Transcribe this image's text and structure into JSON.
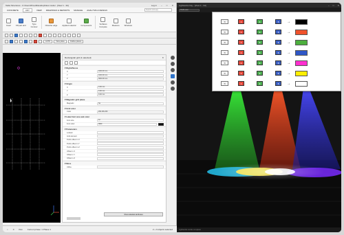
{
  "left_window": {
    "title": "Tekla Structures - C:\\Users\\Proud\\Desktop\\New model - [View 1 - 3d]",
    "user": "Log in",
    "menu_tabs": [
      "CONCRETE",
      "ANY",
      "VIEW",
      "DRAWINGS & REPORTS",
      "MANAGE",
      "ANALYSIS & DESIGN"
    ],
    "active_tab": "ANY",
    "search_placeholder": "Search (Ctrl+Q)",
    "ribbon": [
      {
        "label": "Insert",
        "icon": "insert-icon",
        "color": "plain"
      },
      {
        "label": "Fill part and",
        "icon": "fill-part-icon",
        "color": "blue"
      },
      {
        "label": "Type\nContour",
        "icon": "contour-icon",
        "color": "plain"
      },
      {
        "label": "Chamfer edge",
        "icon": "chamfer-icon",
        "color": "orange"
      },
      {
        "label": "Applied material",
        "icon": "material-icon",
        "color": "plain"
      },
      {
        "label": "Components",
        "icon": "components-icon",
        "color": "green"
      },
      {
        "label": "Surfaces\nCompare",
        "icon": "surface-icon",
        "color": "plain"
      },
      {
        "label": "Measure",
        "icon": "measure-icon",
        "color": "plain"
      },
      {
        "label": "Windows",
        "icon": "window-icon",
        "color": "plain"
      }
    ],
    "toolbar_dropdowns": [
      "AUTO",
      "View plane",
      "Outline planes"
    ],
    "viewport_title": "View 1 - 3d",
    "properties": {
      "title": "Rectangular grid (1 selected)",
      "sections": [
        {
          "name": "Right/Above",
          "rows": [
            {
              "k": "X",
              "v": "1000.00 mm"
            },
            {
              "k": "Y",
              "v": "1000.00 mm"
            },
            {
              "k": "Z",
              "v": "3000.00 mm"
            }
          ]
        },
        {
          "name": "Origin",
          "rows": [
            {
              "k": "X",
              "v": "0.00 mm"
            },
            {
              "k": "Y",
              "v": "0.00 mm"
            },
            {
              "k": "Z",
              "v": "0.00 mm"
            }
          ]
        },
        {
          "name": "Magnetic grid plane",
          "rows": [
            {
              "k": "Magnetic",
              "v": "No"
            }
          ]
        },
        {
          "name": "Grid color",
          "rows": [
            {
              "k": "Color",
              "v": "255 255 255"
            }
          ]
        },
        {
          "name": "Label font size and color",
          "rows": [
            {
              "k": "Font size",
              "v": "12"
            },
            {
              "k": "Font color",
              "v": "0000"
            }
          ]
        },
        {
          "name": "Parameters",
          "rows": [
            {
              "k": "Locked",
              "v": ""
            },
            {
              "k": "Grid element",
              "v": ""
            },
            {
              "k": "Prefix offset in X",
              "v": ""
            },
            {
              "k": "Prefix offset in Y",
              "v": ""
            },
            {
              "k": "Prefix offset in Z",
              "v": ""
            },
            {
              "k": "Offset in X",
              "v": ""
            },
            {
              "k": "Offset in Y",
              "v": ""
            },
            {
              "k": "Offset in Z",
              "v": ""
            }
          ]
        },
        {
          "name": "More",
          "rows": [
            {
              "k": "UDAs",
              "v": ""
            }
          ]
        }
      ],
      "button": "Show labelled attributes"
    },
    "status": {
      "coords": "0",
      "pan": "Pan",
      "phase": "Current phase: 1 Phase 1",
      "selected": "2 + 0 objects selected"
    }
  },
  "right_window": {
    "title": "Lightworks Iray - [View 1 - 3d]",
    "dropdown": "RGB color",
    "status": "Lightworks render complete"
  },
  "color_mapping": {
    "rows": [
      {
        "c1": "1",
        "c1_color": "#e8473a",
        "c2": "3",
        "c2_color": "#4caf50",
        "c3": "5",
        "c3_color": "#3b5fc4",
        "target": "#000000"
      },
      {
        "c1": "1",
        "c1_color": "#e8473a",
        "c2": "3",
        "c2_color": "#4caf50",
        "c3": "5",
        "c3_color": "#3b5fc4",
        "target": "#f0522c"
      },
      {
        "c1": "1",
        "c1_color": "#e8473a",
        "c2": "3",
        "c2_color": "#4caf50",
        "c3": "5",
        "c3_color": "#3b5fc4",
        "target": "#4caf3e"
      },
      {
        "c1": "1",
        "c1_color": "#e8473a",
        "c2": "3",
        "c2_color": "#4caf50",
        "c3": "5",
        "c3_color": "#3b5fc4",
        "target": "#2f57c7"
      },
      {
        "c1": "1",
        "c1_color": "#e8473a",
        "c2": "3",
        "c2_color": "#4caf50",
        "c3": "5",
        "c3_color": "#3b5fc4",
        "target": "#ff2fcf"
      },
      {
        "c1": "1",
        "c1_color": "#e8473a",
        "c2": "3",
        "c2_color": "#4caf50",
        "c3": "5",
        "c3_color": "#3b5fc4",
        "target": "#ffee00"
      },
      {
        "c1": "1",
        "c1_color": "#e8473a",
        "c2": "3",
        "c2_color": "#4caf50",
        "c3": "5",
        "c3_color": "#3b5fc4",
        "target": "#ffffff"
      }
    ],
    "chip_icon": "undo-chip-icon",
    "arrow": "→"
  }
}
